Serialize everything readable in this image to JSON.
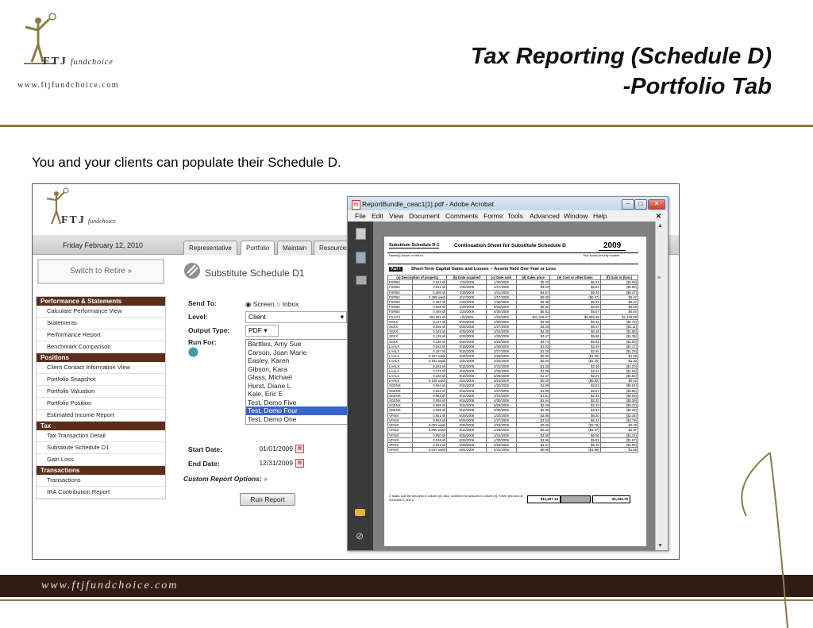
{
  "slide": {
    "title_line1": "Tax Reporting (Schedule D)",
    "title_line2": "-Portfolio Tab",
    "intro": "You and your clients can populate their Schedule D.",
    "logo_letters": "FTJ",
    "logo_sub": "fundchoice",
    "logo_url": "www.ftjfundchoice.com",
    "footer_url": "www.ftjfundchoice.com",
    "accent_gold": "#8a7a45",
    "footer_color": "#2f1d14"
  },
  "app": {
    "logo_letters": "FTJ",
    "logo_sub": "fundchoice",
    "date": "Friday February 12, 2010",
    "tabs": [
      "Representative",
      "Portfolio",
      "Maintain",
      "Resources"
    ],
    "active_tab": "Portfolio",
    "switch_button": "Switch to Retire",
    "nav": [
      {
        "header": "Performance & Statements",
        "items": [
          "Calculate Performance View",
          "Statements",
          "Performance Report",
          "Benchmark Comparison"
        ]
      },
      {
        "header": "Positions",
        "items": [
          "Client Contact Information View",
          "Portfolio Snapshot",
          "Portfolio Valuation",
          "Portfolio Position",
          "Estimated Income Report"
        ]
      },
      {
        "header": "Tax",
        "items": [
          "Tax Transaction Detail",
          "Substitute Schedule D1",
          "Gain Loss"
        ]
      },
      {
        "header": "Transactions",
        "items": [
          "Transactions",
          "IRA Contribution Report"
        ]
      }
    ],
    "page_title": "Substitute Schedule D1",
    "form": {
      "send_to_label": "Send To:",
      "send_to_options": [
        "Screen",
        "Inbox"
      ],
      "send_to_selected": "Screen",
      "level_label": "Level:",
      "level_value": "Client",
      "output_type_label": "Output Type:",
      "output_type_value": "PDF",
      "run_for_label": "Run For:",
      "clients": [
        "Barttles, Amy Sue",
        "Carson, Joan Marie",
        "Easley, Karen",
        "Gibson, Kara",
        "Glass, Michael",
        "Hurst, Diane L",
        "Kale, Eric E",
        "Test, Demo Five",
        "Test, Demo Four",
        "Test, Demo One"
      ],
      "selected_client": "Test, Demo Four",
      "start_date_label": "Start Date:",
      "start_date": "01/01/2009",
      "end_date_label": "End Date:",
      "end_date": "12/31/2009",
      "custom_options_label": "Custom Report Options:",
      "run_button": "Run Report"
    }
  },
  "acrobat": {
    "title": "ReportBundle_ceac1[1].pdf - Adobe Acrobat",
    "menu": [
      "File",
      "Edit",
      "View",
      "Document",
      "Comments",
      "Forms",
      "Tools",
      "Advanced",
      "Window",
      "Help"
    ],
    "doc": {
      "form_name": "Substitute Schedule D-1",
      "heading": "Continuation Sheet for Substitute Schedule D",
      "year": "2009",
      "names_label": "Name(s) shown on return",
      "ssn_label": "Your social security number",
      "part": "Part I",
      "part_title": "Short-Term Capital Gains and Losses -- Assets Held One Year or Less",
      "columns": [
        "(a) Description of property",
        "(b) Date acquired",
        "(c) Date sold",
        "(d) Sales price",
        "(e) Cost or other basis",
        "(f) Gain or (loss)"
      ],
      "rows": [
        [
          "FSRBX",
          "0.521 sh",
          "1/29/2009",
          "1/30/2009",
          "$5.33",
          "$5.41",
          "($0.08)"
        ],
        [
          "FSRBX",
          "0.612 sh",
          "1/29/2009",
          "2/27/2009",
          "$4.63",
          "$5.52",
          "($0.89)"
        ],
        [
          "FSRBX",
          "0.495 sh",
          "1/29/2009",
          "3/31/2009",
          "$4.87",
          "$5.34",
          "($0.47)"
        ],
        [
          "FSRBX",
          "0.496 wash",
          "4/17/2009",
          "4/17/2009",
          "$0.00",
          "($0.47)",
          "$0.47"
        ],
        [
          "FSRBX",
          "0.482 sh",
          "1/29/2009",
          "4/30/2009",
          "$5.48",
          "$5.21",
          "$0.27"
        ],
        [
          "FSRBX",
          "0.468 sh",
          "1/29/2009",
          "5/29/2009",
          "$6.05",
          "$6.05",
          "$0.00"
        ],
        [
          "FSRBX",
          "0.469 sh",
          "1/29/2009",
          "6/30/2009",
          "$5.91",
          "$5.07",
          "$0.84"
        ],
        [
          "FSAGX",
          "363.391 sh",
          "1/5/2009",
          "1/29/2009",
          "$11,345.07",
          "$9,995.99",
          "$1,349.08"
        ],
        [
          "SGIIX",
          "0.147 sh",
          "6/29/2008",
          "1/30/2009",
          "$4.58",
          "$6.34",
          "($1.76)"
        ],
        [
          "SGIIX",
          "0.165 sh",
          "6/29/2008",
          "2/27/2009",
          "$4.36",
          "$6.47",
          "($2.11)"
        ],
        [
          "SGIIX",
          "0.145 sh",
          "6/29/2008",
          "3/31/2009",
          "$4.40",
          "$6.25",
          "($1.85)"
        ],
        [
          "SGIIX",
          "0.135 sh",
          "6/29/2008",
          "4/30/2009",
          "$4.47",
          "$5.86",
          "($1.39)"
        ],
        [
          "SGIIX",
          "0.135 sh",
          "6/29/2008",
          "5/29/2009",
          "$4.74",
          "$5.82",
          "($1.08)"
        ],
        [
          "LAALX",
          "0.183 sh",
          "9/15/2008",
          "1/30/2009",
          "$1.32",
          "$2.49",
          "($1.17)"
        ],
        [
          "LAALX",
          "0.187 sh",
          "9/15/2008",
          "2/27/2009",
          "$1.26",
          "$2.55",
          "($1.29)"
        ],
        [
          "LAALX",
          "0.187 wash",
          "3/26/2009",
          "3/26/2009",
          "$0.00",
          "($1.29)",
          "$1.29"
        ],
        [
          "LAALX",
          "0.181 wash",
          "3/31/2009",
          "3/26/2009",
          "$0.00",
          "($1.20)",
          "$1.20"
        ],
        [
          "LAALX",
          "0.181 sh",
          "9/15/2008",
          "3/31/2009",
          "$1.26",
          "$2.46",
          "($1.20)"
        ],
        [
          "LAALX",
          "0.172 sh",
          "9/15/2008",
          "4/30/2009",
          "$1.28",
          "$2.34",
          "($1.06)"
        ],
        [
          "LAALX",
          "0.168 sh",
          "9/15/2008",
          "5/29/2009",
          "$1.37",
          "$2.29",
          "($0.92)"
        ],
        [
          "LAALX",
          "0.168 wash",
          "6/24/2009",
          "6/24/2009",
          "$0.00",
          "($0.92)",
          "$0.92"
        ],
        [
          "SGENX",
          "0.064 sh",
          "9/15/2008",
          "1/30/2009",
          "$1.99",
          "$2.53",
          "($0.54)"
        ],
        [
          "SGENX",
          "0.064 sh",
          "9/15/2008",
          "2/27/2009",
          "$1.89",
          "$2.57",
          "($0.68)"
        ],
        [
          "SGENX",
          "0.063 sh",
          "9/15/2008",
          "3/31/2009",
          "$1.91",
          "$2.49",
          "($0.58)"
        ],
        [
          "SGENX",
          "0.059 sh",
          "9/15/2008",
          "4/30/2009",
          "$1.94",
          "$2.33",
          "($0.39)"
        ],
        [
          "SGENX",
          "0.059 sh",
          "9/15/2008",
          "5/29/2009",
          "$2.06",
          "$2.33",
          "($0.27)"
        ],
        [
          "SGENX",
          "0.059 sh",
          "9/15/2008",
          "6/30/2009",
          "$2.05",
          "$2.33",
          "($0.28)"
        ],
        [
          "VFINX",
          "0.051 sh",
          "6/29/2008",
          "1/30/2009",
          "$3.86",
          "$6.20",
          "($2.34)"
        ],
        [
          "VFINX",
          "0.052 sh",
          "6/29/2008",
          "2/27/2009",
          "$3.53",
          "$6.32",
          "($2.79)"
        ],
        [
          "VFINX",
          "0.052 wash",
          "3/26/2009",
          "3/26/2009",
          "$0.00",
          "($2.79)",
          "$2.79"
        ],
        [
          "VFINX",
          "0.050 wash",
          "3/31/2009",
          "3/26/2009",
          "$0.00",
          "($2.37)",
          "$2.37"
        ],
        [
          "VFINX",
          "0.050 sh",
          "6/29/2008",
          "3/31/2009",
          "$3.69",
          "$6.06",
          "($2.37)"
        ],
        [
          "VFINX",
          "0.048 sh",
          "6/29/2008",
          "4/30/2009",
          "$3.95",
          "$5.82",
          "($1.87)"
        ],
        [
          "VFINX",
          "0.047 sh",
          "6/29/2008",
          "5/29/2009",
          "$4.01",
          "$5.70",
          "($1.69)"
        ],
        [
          "VFINX",
          "0.047 wash",
          "6/24/2009",
          "6/24/2009",
          "$0.00",
          "($1.69)",
          "$1.69"
        ]
      ],
      "totals_note": "2   Totals. Add the amounts in column (d). Also, combine the amounts in column (f). Enter here and on Schedule D, line 2",
      "total_sales": "$11,407.16",
      "total_gain": "$1,242.76"
    }
  }
}
